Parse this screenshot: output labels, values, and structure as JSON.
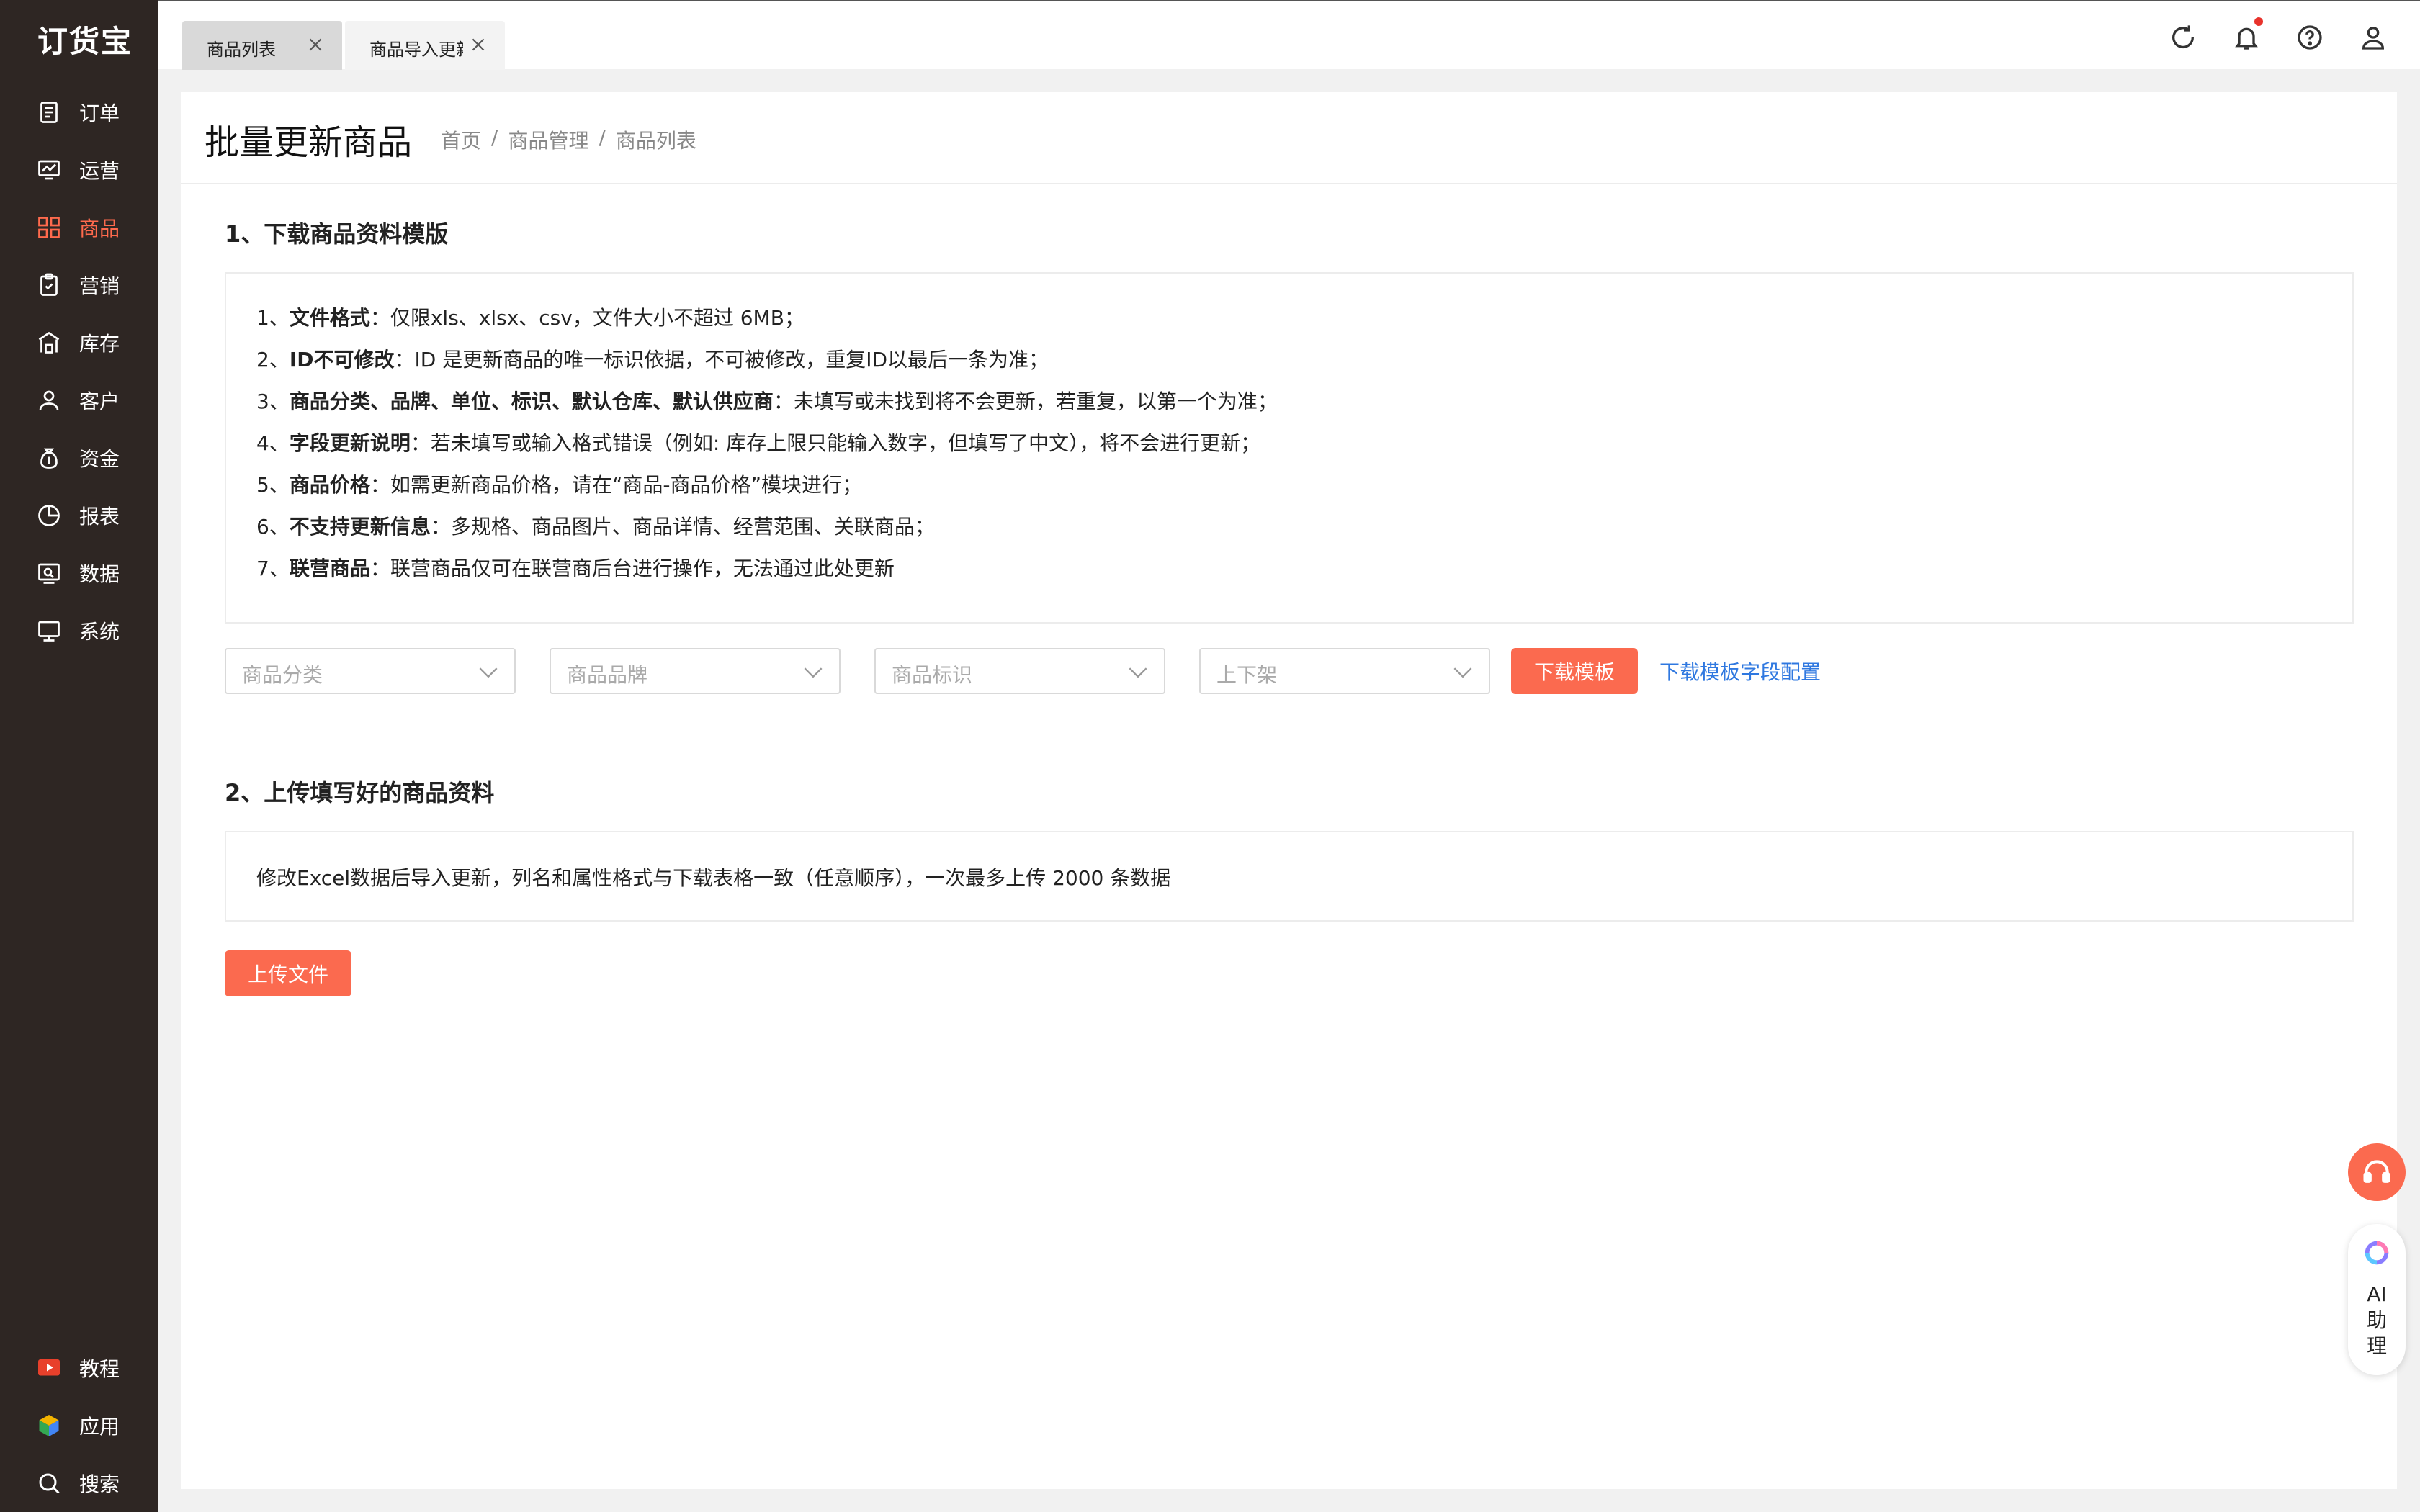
{
  "app": {
    "logo": "订货宝"
  },
  "sidebar": {
    "items": [
      {
        "label": "订单",
        "icon": "order-icon"
      },
      {
        "label": "运营",
        "icon": "operation-icon"
      },
      {
        "label": "商品",
        "icon": "goods-icon",
        "active": true
      },
      {
        "label": "营销",
        "icon": "marketing-icon"
      },
      {
        "label": "库存",
        "icon": "warehouse-icon"
      },
      {
        "label": "客户",
        "icon": "customer-icon"
      },
      {
        "label": "资金",
        "icon": "money-icon"
      },
      {
        "label": "报表",
        "icon": "report-icon"
      },
      {
        "label": "数据",
        "icon": "data-icon"
      },
      {
        "label": "系统",
        "icon": "system-icon"
      }
    ],
    "bottom": [
      {
        "label": "教程",
        "icon": "tutorial-icon"
      },
      {
        "label": "应用",
        "icon": "app-icon"
      },
      {
        "label": "搜索",
        "icon": "search-icon"
      }
    ]
  },
  "tabs": [
    {
      "label": "商品列表"
    },
    {
      "label": "商品导入更新"
    }
  ],
  "header": {
    "title": "批量更新商品",
    "breadcrumb": [
      "首页",
      "商品管理",
      "商品列表"
    ]
  },
  "section1": {
    "title": "1、下载商品资料模版",
    "rules": [
      {
        "num": "1、",
        "bold": "文件格式",
        "text": "：仅限xls、xlsx、csv，文件大小不超过 6MB；"
      },
      {
        "num": "2、",
        "bold": "ID不可修改",
        "text": "：ID 是更新商品的唯一标识依据，不可被修改，重复ID以最后一条为准；"
      },
      {
        "num": "3、",
        "bold": "商品分类、品牌、单位、标识、默认仓库、默认供应商",
        "text": "：未填写或未找到将不会更新，若重复，以第一个为准；"
      },
      {
        "num": "4、",
        "bold": "字段更新说明",
        "text": "：若未填写或输入格式错误（例如: 库存上限只能输入数字，但填写了中文），将不会进行更新；"
      },
      {
        "num": "5、",
        "bold": "商品价格",
        "text": "：如需更新商品价格，请在“商品-商品价格”模块进行；"
      },
      {
        "num": "6、",
        "bold": "不支持更新信息",
        "text": "：多规格、商品图片、商品详情、经营范围、关联商品；"
      },
      {
        "num": "7、",
        "bold": "联营商品",
        "text": "：联营商品仅可在联营商后台进行操作，无法通过此处更新"
      }
    ],
    "filters": [
      {
        "placeholder": "商品分类"
      },
      {
        "placeholder": "商品品牌"
      },
      {
        "placeholder": "商品标识"
      },
      {
        "placeholder": "上下架"
      }
    ],
    "download_button": "下载模板",
    "config_link": "下载模板字段配置"
  },
  "section2": {
    "title": "2、上传填写好的商品资料",
    "desc": "修改Excel数据后导入更新，列名和属性格式与下载表格一致（任意顺序），一次最多上传 2000 条数据",
    "upload_button": "上传文件"
  },
  "float": {
    "ai_label_1": "AI",
    "ai_label_2": "助",
    "ai_label_3": "理"
  },
  "colors": {
    "accent": "#fb6a4f",
    "sidebar": "#2e2623",
    "link": "#2f78e0"
  }
}
